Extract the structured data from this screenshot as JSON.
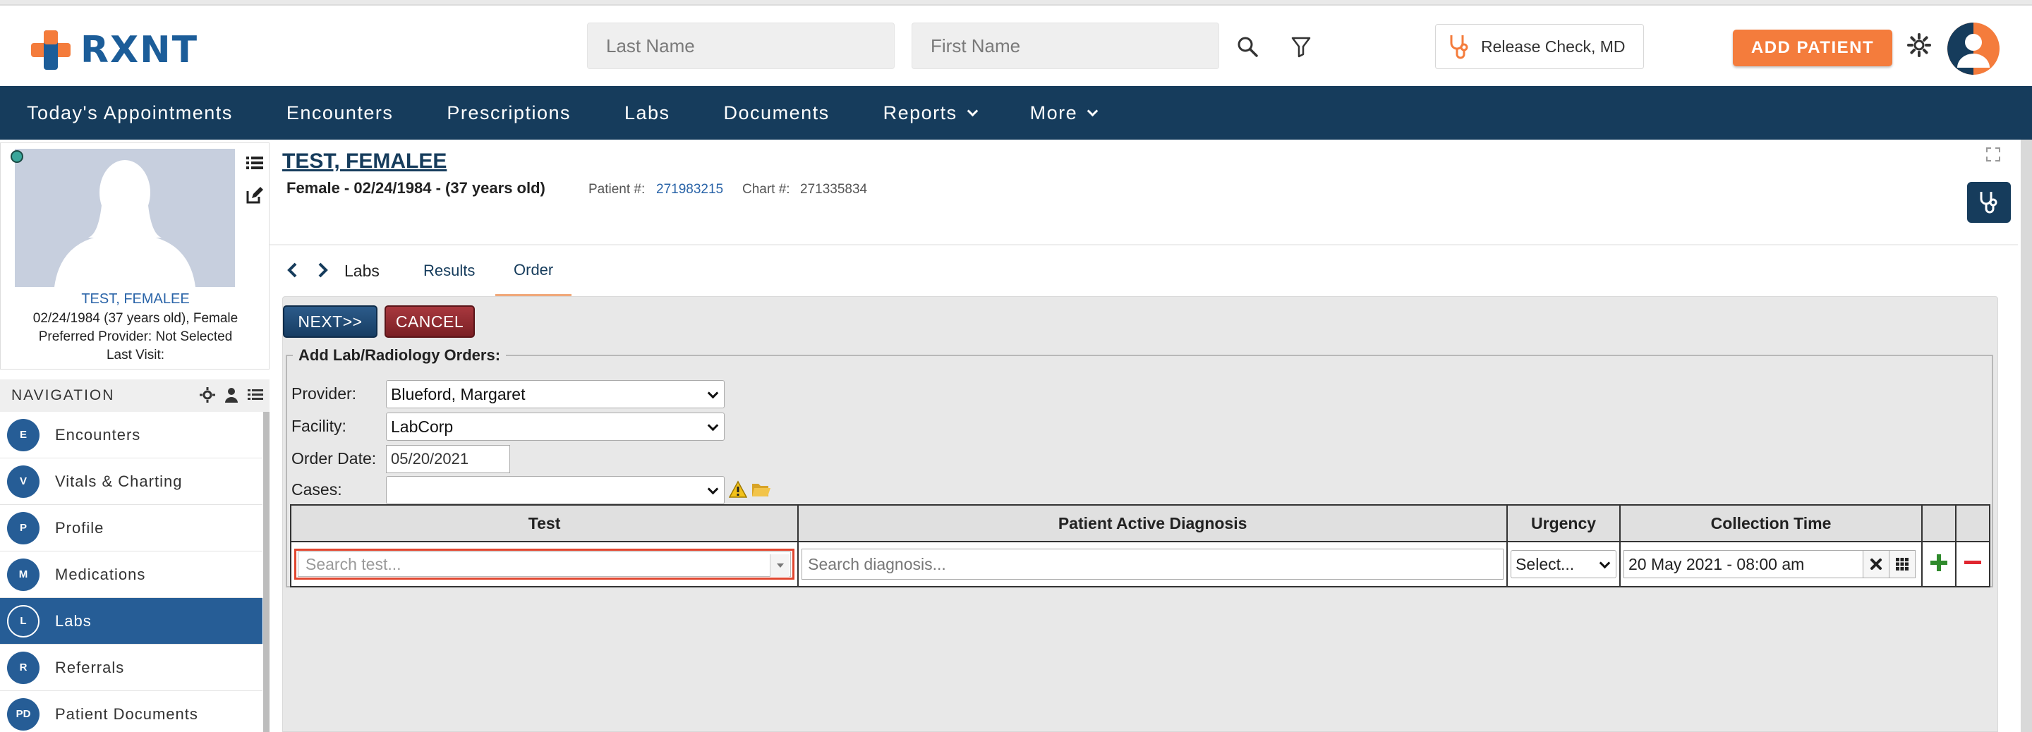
{
  "header": {
    "logo_text": "RXNT",
    "last_name_placeholder": "Last Name",
    "first_name_placeholder": "First Name",
    "provider_label": "Release Check, MD",
    "add_patient_label": "ADD PATIENT"
  },
  "nav": {
    "items": [
      {
        "label": "Today's Appointments",
        "dropdown": false
      },
      {
        "label": "Encounters",
        "dropdown": false
      },
      {
        "label": "Prescriptions",
        "dropdown": false
      },
      {
        "label": "Labs",
        "dropdown": false
      },
      {
        "label": "Documents",
        "dropdown": false
      },
      {
        "label": "Reports",
        "dropdown": true
      },
      {
        "label": "More",
        "dropdown": true
      }
    ]
  },
  "patient_card": {
    "name": "TEST, FEMALEE",
    "dob_line": "02/24/1984 (37 years old), Female",
    "provider_line": "Preferred Provider: Not Selected",
    "last_visit_line": "Last Visit:"
  },
  "sidebar": {
    "title": "NAVIGATION",
    "items": [
      {
        "abbr": "E",
        "label": "Encounters",
        "active": false
      },
      {
        "abbr": "V",
        "label": "Vitals & Charting",
        "active": false
      },
      {
        "abbr": "P",
        "label": "Profile",
        "active": false
      },
      {
        "abbr": "M",
        "label": "Medications",
        "active": false
      },
      {
        "abbr": "L",
        "label": "Labs",
        "active": true
      },
      {
        "abbr": "R",
        "label": "Referrals",
        "active": false
      },
      {
        "abbr": "PD",
        "label": "Patient Documents",
        "active": false
      }
    ]
  },
  "patient_header": {
    "name": "TEST, FEMALEE",
    "info": "Female - 02/24/1984 - (37 years old)",
    "patient_num_label": "Patient #:",
    "patient_num": "271983215",
    "chart_num_label": "Chart #:",
    "chart_num": "271335834"
  },
  "tabs": {
    "section": "Labs",
    "items": [
      "Results",
      "Order"
    ],
    "active": "Order"
  },
  "form": {
    "next_label": "NEXT>>",
    "cancel_label": "CANCEL",
    "legend": "Add Lab/Radiology Orders:",
    "provider_label": "Provider:",
    "provider_value": "Blueford, Margaret",
    "facility_label": "Facility:",
    "facility_value": "LabCorp",
    "order_date_label": "Order Date:",
    "order_date_value": "05/20/2021",
    "cases_label": "Cases:",
    "cases_value": ""
  },
  "orders_table": {
    "headers": [
      "Test",
      "Patient Active Diagnosis",
      "Urgency",
      "Collection Time"
    ],
    "test_placeholder": "Search test...",
    "diagnosis_placeholder": "Search diagnosis...",
    "urgency_value": "Select...",
    "collection_time_value": "20 May 2021 - 08:00 am"
  },
  "colors": {
    "brand_blue": "#1c5d99",
    "nav_bg": "#163c5c",
    "accent_orange": "#f47c3c",
    "active_blue": "#265d96",
    "highlight_red": "#e0462f"
  }
}
